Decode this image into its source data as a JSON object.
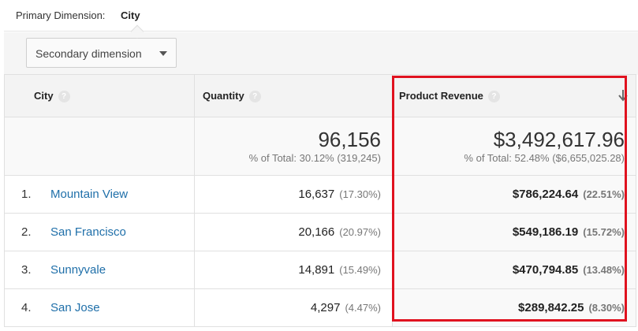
{
  "primary": {
    "label": "Primary Dimension:",
    "value": "City"
  },
  "secondary": {
    "label": "Secondary dimension"
  },
  "headers": {
    "city": "City",
    "quantity": "Quantity",
    "revenue": "Product Revenue"
  },
  "totals": {
    "quantity": "96,156",
    "quantity_sub": "% of Total: 30.12% (319,245)",
    "revenue": "$3,492,617.96",
    "revenue_sub": "% of Total: 52.48% ($6,655,025.28)"
  },
  "rows": [
    {
      "num": "1.",
      "city": "Mountain View",
      "qty": "16,637",
      "qty_pct": "(17.30%)",
      "rev": "$786,224.64",
      "rev_pct": "(22.51%)"
    },
    {
      "num": "2.",
      "city": "San Francisco",
      "qty": "20,166",
      "qty_pct": "(20.97%)",
      "rev": "$549,186.19",
      "rev_pct": "(15.72%)"
    },
    {
      "num": "3.",
      "city": "Sunnyvale",
      "qty": "14,891",
      "qty_pct": "(15.49%)",
      "rev": "$470,794.85",
      "rev_pct": "(13.48%)"
    },
    {
      "num": "4.",
      "city": "San Jose",
      "qty": "4,297",
      "qty_pct": "(4.47%)",
      "rev": "$289,842.25",
      "rev_pct": "(8.30%)"
    }
  ],
  "icons": {
    "help": "help-icon",
    "sort": "sort-down-arrow-icon",
    "caret": "chevron-down-icon"
  },
  "colors": {
    "link": "#1f6fa9",
    "highlight": "#e0121f"
  }
}
